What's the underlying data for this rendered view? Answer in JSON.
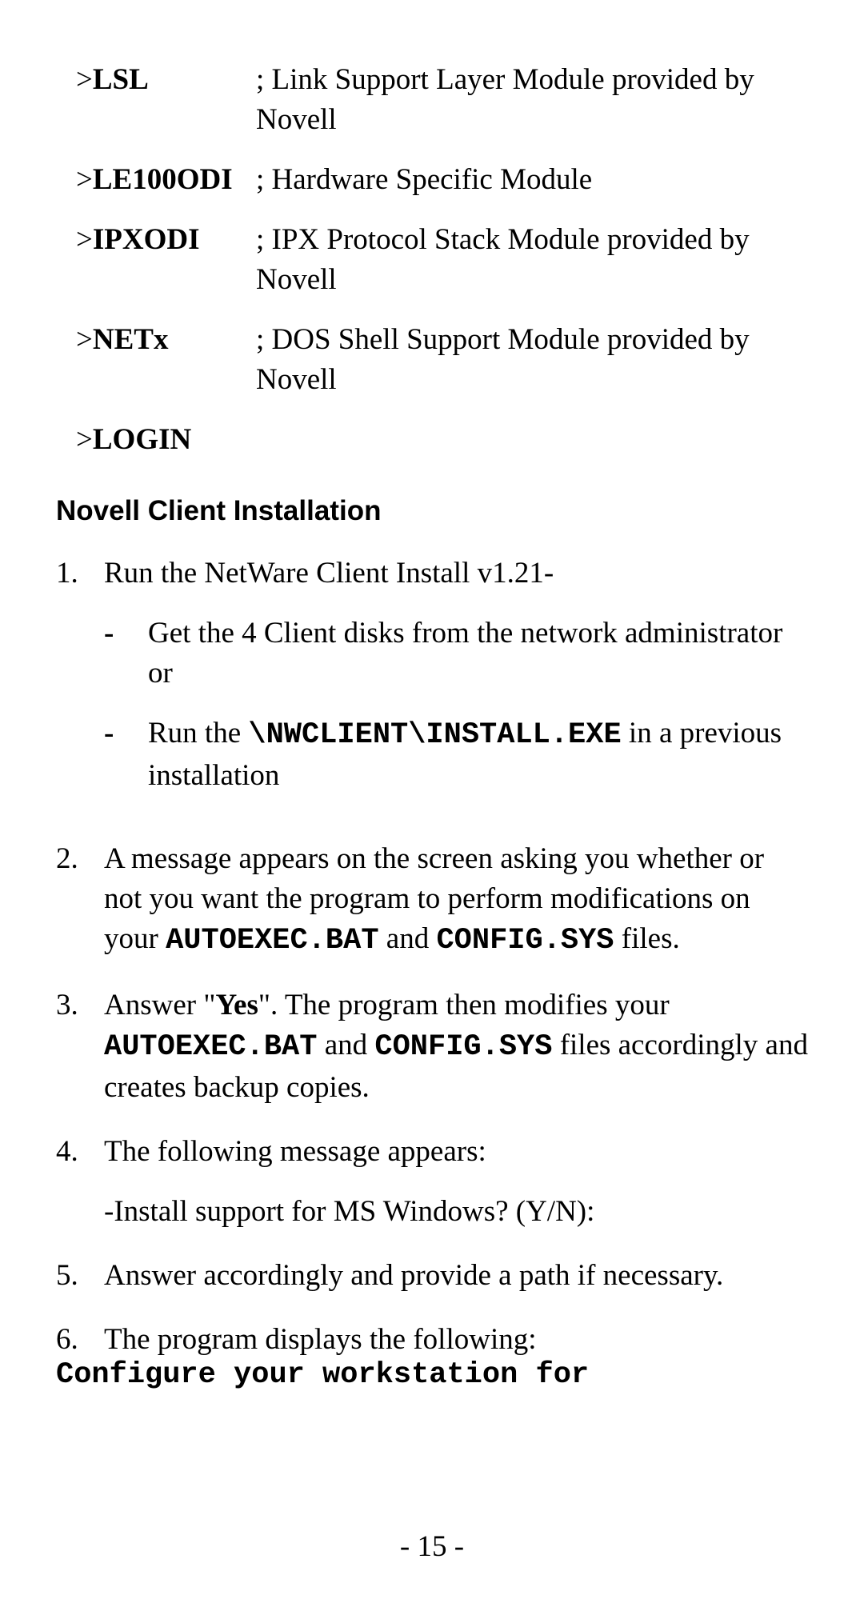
{
  "modules": [
    {
      "cmd": "LSL",
      "desc": "; Link Support Layer Module provided by Novell"
    },
    {
      "cmd": "LE100ODI",
      "desc": "; Hardware Specific Module"
    },
    {
      "cmd": "IPXODI",
      "desc": "; IPX Protocol Stack Module provided by Novell"
    },
    {
      "cmd": "NETx",
      "desc": "; DOS Shell Support Module provided by Novell"
    }
  ],
  "login_cmd": "LOGIN",
  "gt": ">",
  "section_heading": "Novell Client Installation",
  "steps": {
    "s1": {
      "num": "1.",
      "text": "Run the NetWare Client Install v1.21-",
      "sub": {
        "a": {
          "dash": "-",
          "text": "Get the 4 Client disks from the network administrator or"
        },
        "b": {
          "dash": "-",
          "pre": "Run the ",
          "code": "\\NWCLIENT\\INSTALL.EXE",
          "post": " in a previous installation"
        }
      }
    },
    "s2": {
      "num": "2.",
      "pre": "A message appears on the screen asking you whether or not you want the program to perform modifications on your ",
      "code1": "AUTOEXEC.BAT",
      "mid": " and ",
      "code2": "CONFIG.SYS",
      "post": " files."
    },
    "s3": {
      "num": "3.",
      "pre": "Answer \"",
      "yes": "Yes",
      "mid1": "\".  The program then modifies your ",
      "code1": "AUTOEXEC.BAT",
      "mid2": " and ",
      "code2": "CONFIG.SYS",
      "post": " files accordingly and creates backup copies."
    },
    "s4": {
      "num": "4.",
      "line1": "The following message appears:",
      "line2": "-Install support for MS Windows? (Y/N):"
    },
    "s5": {
      "num": "5.",
      "text": "Answer accordingly and provide a path if necessary."
    },
    "s6": {
      "num": "6.",
      "text": "The program displays the following:"
    }
  },
  "trailing_code": "Configure your workstation for",
  "page_number": "- 15 -"
}
